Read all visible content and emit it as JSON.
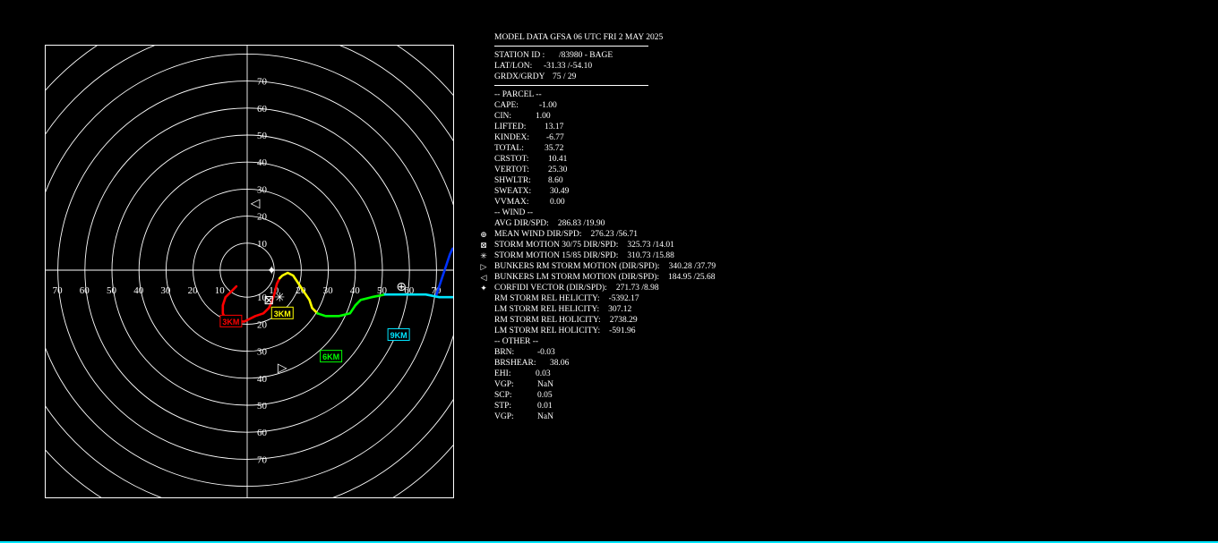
{
  "header": {
    "title": "MODEL DATA GFSA 06 UTC FRI 2 MAY 2025"
  },
  "station": {
    "id_label": "STATION ID :",
    "id_value": "/83980  - BAGE",
    "latlon_label": "LAT/LON:",
    "latlon_value": "-31.33 /-54.10",
    "grd_label": "GRDX/GRDY",
    "grd_value": "75 /   29"
  },
  "sections": {
    "parcel": "-- PARCEL --",
    "wind": "-- WIND --",
    "other": "-- OTHER --"
  },
  "parcel": [
    {
      "label": "CAPE:",
      "value": "-1.00"
    },
    {
      "label": "CIN:",
      "value": "1.00"
    },
    {
      "label": "LIFTED:",
      "value": "13.17"
    },
    {
      "label": "KINDEX:",
      "value": "-6.77"
    },
    {
      "label": "TOTAL:",
      "value": "35.72"
    },
    {
      "label": "CRSTOT:",
      "value": "10.41"
    },
    {
      "label": "VERTOT:",
      "value": "25.30"
    },
    {
      "label": "SHWLTR:",
      "value": "8.60"
    },
    {
      "label": "SWEATX:",
      "value": "30.49"
    },
    {
      "label": "VVMAX:",
      "value": "0.00"
    }
  ],
  "wind": [
    {
      "label": "AVG DIR/SPD:",
      "value": "286.83 /19.90",
      "icon": ""
    },
    {
      "label": "MEAN WIND DIR/SPD:",
      "value": "276.23 /56.71",
      "icon": "⊕"
    },
    {
      "label": "STORM MOTION 30/75 DIR/SPD:",
      "value": "325.73 /14.01",
      "icon": "⊠"
    },
    {
      "label": "STORM MOTION 15/85 DIR/SPD:",
      "value": "310.73 /15.88",
      "icon": "✳"
    },
    {
      "label": "BUNKERS RM STORM MOTION (DIR/SPD):",
      "value": "340.28 /37.79",
      "icon": "▷"
    },
    {
      "label": "BUNKERS LM STORM MOTION (DIR/SPD):",
      "value": "184.95 /25.68",
      "icon": "◁"
    },
    {
      "label": "CORFIDI VECTOR (DIR/SPD):",
      "value": "271.73 /8.98",
      "icon": "✦"
    },
    {
      "label": "RM STORM REL HELICITY:",
      "value": "-5392.17",
      "icon": ""
    },
    {
      "label": "LM STORM REL HELICITY:",
      "value": "307.12",
      "icon": ""
    },
    {
      "label": "RM STORM REL HOLICITY:",
      "value": "2738.29",
      "icon": ""
    },
    {
      "label": "LM STORM REL HOLICITY:",
      "value": "-591.96",
      "icon": ""
    }
  ],
  "other": [
    {
      "label": "BRN:",
      "value": "-0.03"
    },
    {
      "label": "BRSHEAR:",
      "value": "38.06"
    },
    {
      "label": "EHI:",
      "value": "0.03"
    },
    {
      "label": "VGP:",
      "value": "NaN"
    },
    {
      "label": "SCP:",
      "value": "0.05"
    },
    {
      "label": "STP:",
      "value": "0.01"
    },
    {
      "label": "VGP:",
      "value": "NaN"
    }
  ],
  "chart_data": {
    "type": "hodograph",
    "rings": [
      10,
      20,
      30,
      40,
      50,
      60,
      70,
      80,
      90,
      100
    ],
    "axis_ticks": [
      10,
      20,
      30,
      40,
      50,
      60,
      70
    ],
    "grid": true,
    "colors": {
      "segment_0_3km": "#ff0000",
      "segment_3_6km": "#ffff00",
      "segment_6_9km": "#00ff00",
      "segment_9_12km": "#00e5ff",
      "segment_upper": "#0033ff"
    },
    "hodograph_segments": [
      {
        "color": "#ff0000",
        "points": [
          [
            -4,
            -6
          ],
          [
            -6,
            -8
          ],
          [
            -8,
            -10
          ],
          [
            -9,
            -13
          ],
          [
            -9,
            -16
          ],
          [
            -8,
            -18
          ],
          [
            -5,
            -19
          ],
          [
            -1,
            -19
          ],
          [
            3,
            -17
          ],
          [
            6,
            -16
          ],
          [
            8,
            -14
          ],
          [
            9,
            -12
          ],
          [
            10,
            -9
          ],
          [
            11,
            -5
          ],
          [
            12,
            -3
          ]
        ]
      },
      {
        "color": "#ffff00",
        "points": [
          [
            12,
            -3
          ],
          [
            13,
            -2
          ],
          [
            15,
            -1
          ],
          [
            17,
            -2
          ],
          [
            19,
            -5
          ],
          [
            21,
            -8
          ],
          [
            23,
            -11
          ],
          [
            24,
            -14
          ],
          [
            26,
            -16
          ]
        ]
      },
      {
        "color": "#00ff00",
        "points": [
          [
            26,
            -16
          ],
          [
            29,
            -17
          ],
          [
            34,
            -17
          ],
          [
            38,
            -16
          ],
          [
            40,
            -13
          ],
          [
            42,
            -11
          ],
          [
            46,
            -10
          ],
          [
            51,
            -9
          ]
        ]
      },
      {
        "color": "#00e5ff",
        "points": [
          [
            51,
            -9
          ],
          [
            56,
            -9
          ],
          [
            61,
            -9
          ],
          [
            66,
            -9
          ],
          [
            71,
            -10
          ],
          [
            76,
            -10
          ],
          [
            82,
            -10
          ]
        ]
      },
      {
        "color": "#0033ff",
        "points": [
          [
            70,
            -9
          ],
          [
            71,
            -6
          ],
          [
            72,
            -3
          ],
          [
            73,
            0
          ],
          [
            74,
            3
          ],
          [
            75,
            6
          ],
          [
            76,
            8
          ]
        ]
      }
    ],
    "height_labels": [
      {
        "text": "3KM",
        "u": -6,
        "v": -19,
        "color": "#ff0000"
      },
      {
        "text": "3KM",
        "u": 13,
        "v": -16,
        "color": "#ffff00"
      },
      {
        "text": "6KM",
        "u": 31,
        "v": -32,
        "color": "#00ff00"
      },
      {
        "text": "9KM",
        "u": 56,
        "v": -24,
        "color": "#00e5ff"
      }
    ],
    "markers": [
      {
        "icon": "⊕",
        "u": 57,
        "v": -6,
        "name": "mean-wind-marker"
      },
      {
        "icon": "⊠",
        "u": 8,
        "v": -11,
        "name": "storm-motion-30-75-marker"
      },
      {
        "icon": "✳",
        "u": 12,
        "v": -10,
        "name": "storm-motion-15-85-marker"
      },
      {
        "icon": "▷",
        "u": 13,
        "v": -36,
        "name": "bunkers-rm-marker"
      },
      {
        "icon": "◁",
        "u": 3,
        "v": 25,
        "name": "bunkers-lm-marker"
      },
      {
        "icon": "✦",
        "u": 9,
        "v": 0,
        "name": "corfidi-marker"
      }
    ]
  }
}
